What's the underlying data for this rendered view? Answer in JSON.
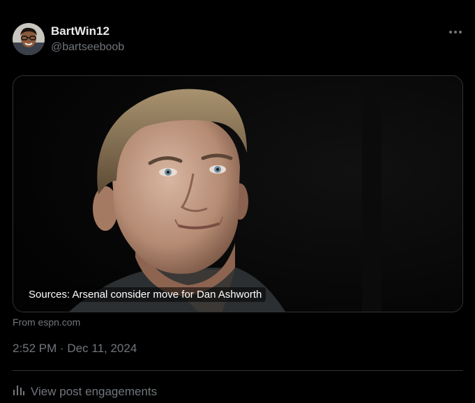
{
  "author": {
    "display_name": "BartWin12",
    "handle": "@bartseeboob"
  },
  "card": {
    "title": "Sources: Arsenal consider move for Dan Ashworth",
    "source": "From espn.com"
  },
  "post": {
    "timestamp": "2:52 PM · Dec 11, 2024"
  },
  "actions": {
    "view_engagements": "View post engagements"
  },
  "icons": {
    "more": "more-horizontal-icon",
    "analytics": "analytics-bars-icon"
  },
  "colors": {
    "background": "#000000",
    "primary_text": "#e7e9ea",
    "secondary_text": "#71767b",
    "border": "#2f3336"
  }
}
